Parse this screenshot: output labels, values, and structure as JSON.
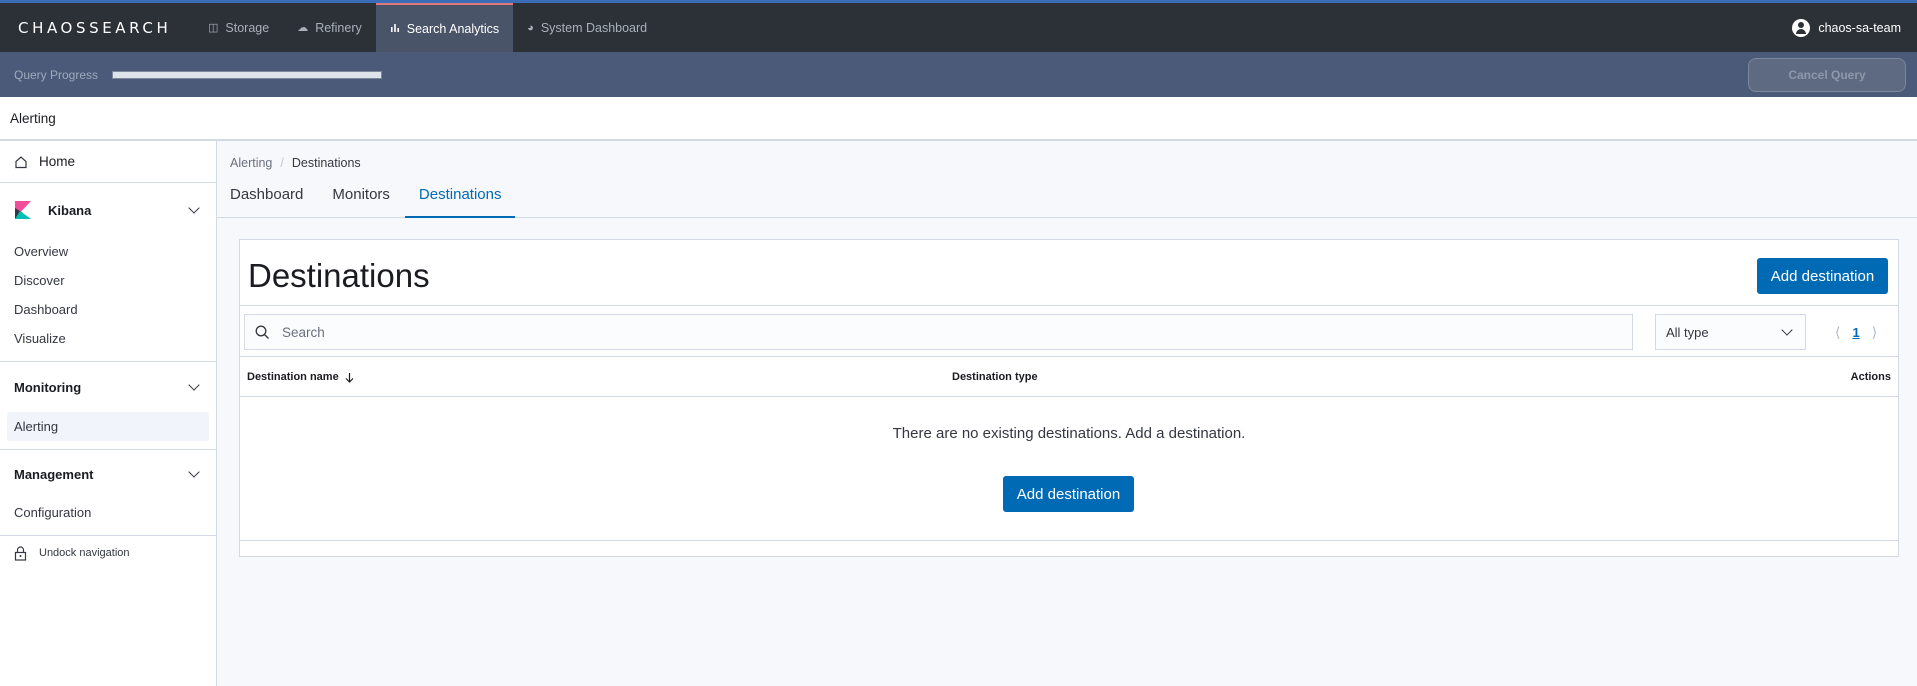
{
  "brand": "CHAOSSEARCH",
  "topnav": {
    "tabs": [
      {
        "label": "Storage",
        "icon": "storage-icon"
      },
      {
        "label": "Refinery",
        "icon": "cloud-icon"
      },
      {
        "label": "Search Analytics",
        "icon": "bar-chart-icon"
      },
      {
        "label": "System Dashboard",
        "icon": "gauge-icon"
      }
    ],
    "active_tab": "Search Analytics",
    "user": "chaos-sa-team"
  },
  "query_progress": {
    "label": "Query Progress",
    "fraction": 1.0,
    "cancel_label": "Cancel Query"
  },
  "header": {
    "title": "Alerting"
  },
  "sidebar": {
    "home": "Home",
    "groups": [
      {
        "title": "Kibana",
        "items": [
          "Overview",
          "Discover",
          "Dashboard",
          "Visualize"
        ]
      },
      {
        "title": "Monitoring",
        "items": [
          "Alerting"
        ]
      },
      {
        "title": "Management",
        "items": [
          "Configuration"
        ]
      }
    ],
    "active_item": "Alerting",
    "undock": "Undock navigation"
  },
  "breadcrumb": {
    "parent": "Alerting",
    "current": "Destinations"
  },
  "tabs": [
    "Dashboard",
    "Monitors",
    "Destinations"
  ],
  "active_tab": "Destinations",
  "panel": {
    "title": "Destinations",
    "add_button": "Add destination",
    "search_placeholder": "Search",
    "type_filter": "All type",
    "page": "1",
    "columns": {
      "name": "Destination name",
      "type": "Destination type",
      "actions": "Actions"
    },
    "empty_message": "There are no existing destinations. Add a destination.",
    "empty_button": "Add destination"
  },
  "colors": {
    "accent": "#006bb4",
    "topbar": "#2c3138",
    "progressbar": "#4b5a78"
  }
}
